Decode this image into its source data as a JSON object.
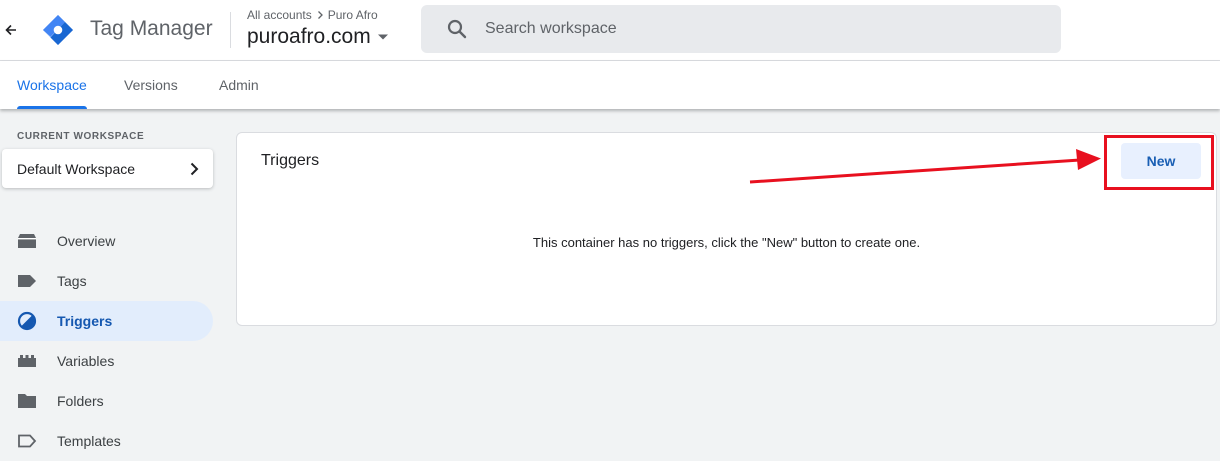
{
  "header": {
    "app_title": "Tag Manager",
    "breadcrumb": {
      "all_accounts": "All accounts",
      "account": "Puro Afro"
    },
    "container_name": "puroafro.com",
    "search_placeholder": "Search workspace"
  },
  "tabs": [
    {
      "label": "Workspace",
      "active": true
    },
    {
      "label": "Versions",
      "active": false
    },
    {
      "label": "Admin",
      "active": false
    }
  ],
  "sidebar": {
    "current_workspace_label": "CURRENT WORKSPACE",
    "workspace_name": "Default Workspace",
    "items": [
      {
        "label": "Overview",
        "icon": "overview-icon",
        "active": false
      },
      {
        "label": "Tags",
        "icon": "tag-icon",
        "active": false
      },
      {
        "label": "Triggers",
        "icon": "trigger-icon",
        "active": true
      },
      {
        "label": "Variables",
        "icon": "variables-icon",
        "active": false
      },
      {
        "label": "Folders",
        "icon": "folder-icon",
        "active": false
      },
      {
        "label": "Templates",
        "icon": "template-icon",
        "active": false
      }
    ]
  },
  "main": {
    "panel_title": "Triggers",
    "new_button_label": "New",
    "empty_message": "This container has no triggers, click the \"New\" button to create one."
  },
  "colors": {
    "accent": "#1a73e8",
    "annotation": "#e8101f",
    "active_nav_bg": "#e2edfc"
  }
}
